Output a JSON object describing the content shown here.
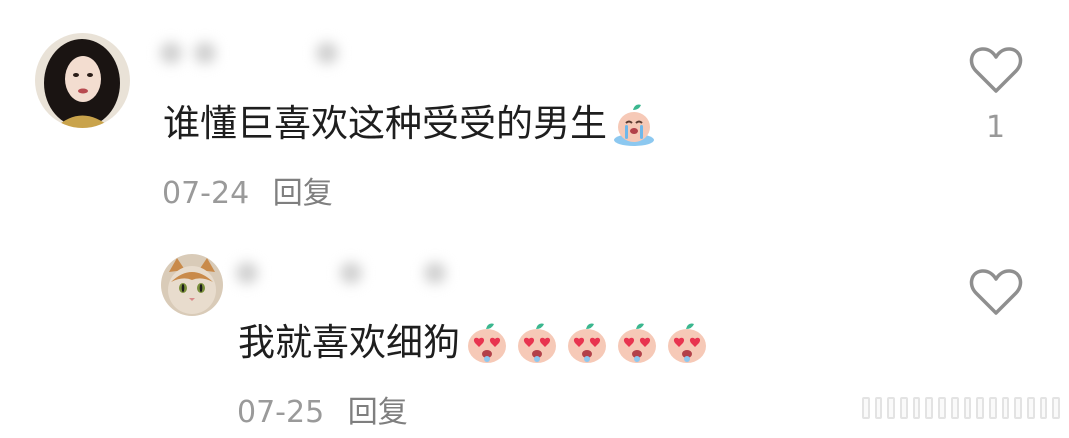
{
  "comments": [
    {
      "text": "谁懂巨喜欢这种受受的男生",
      "emojis": [
        "crying-peach-emoji"
      ],
      "date": "07-24",
      "reply_label": "回复",
      "like_count": "1"
    },
    {
      "text": "我就喜欢细狗",
      "emojis": [
        "heart-eyes-peach-emoji",
        "heart-eyes-peach-emoji",
        "heart-eyes-peach-emoji",
        "heart-eyes-peach-emoji",
        "heart-eyes-peach-emoji"
      ],
      "date": "07-25",
      "reply_label": "回复"
    }
  ],
  "colors": {
    "text": "#1e1e1e",
    "meta": "#9a9a9a",
    "icon": "#8f8f8f",
    "emoji_peach": "#f6c9b7",
    "emoji_leaf": "#3bb78f",
    "emoji_heart": "#e8344f",
    "emoji_tear": "#6fb7ea"
  }
}
